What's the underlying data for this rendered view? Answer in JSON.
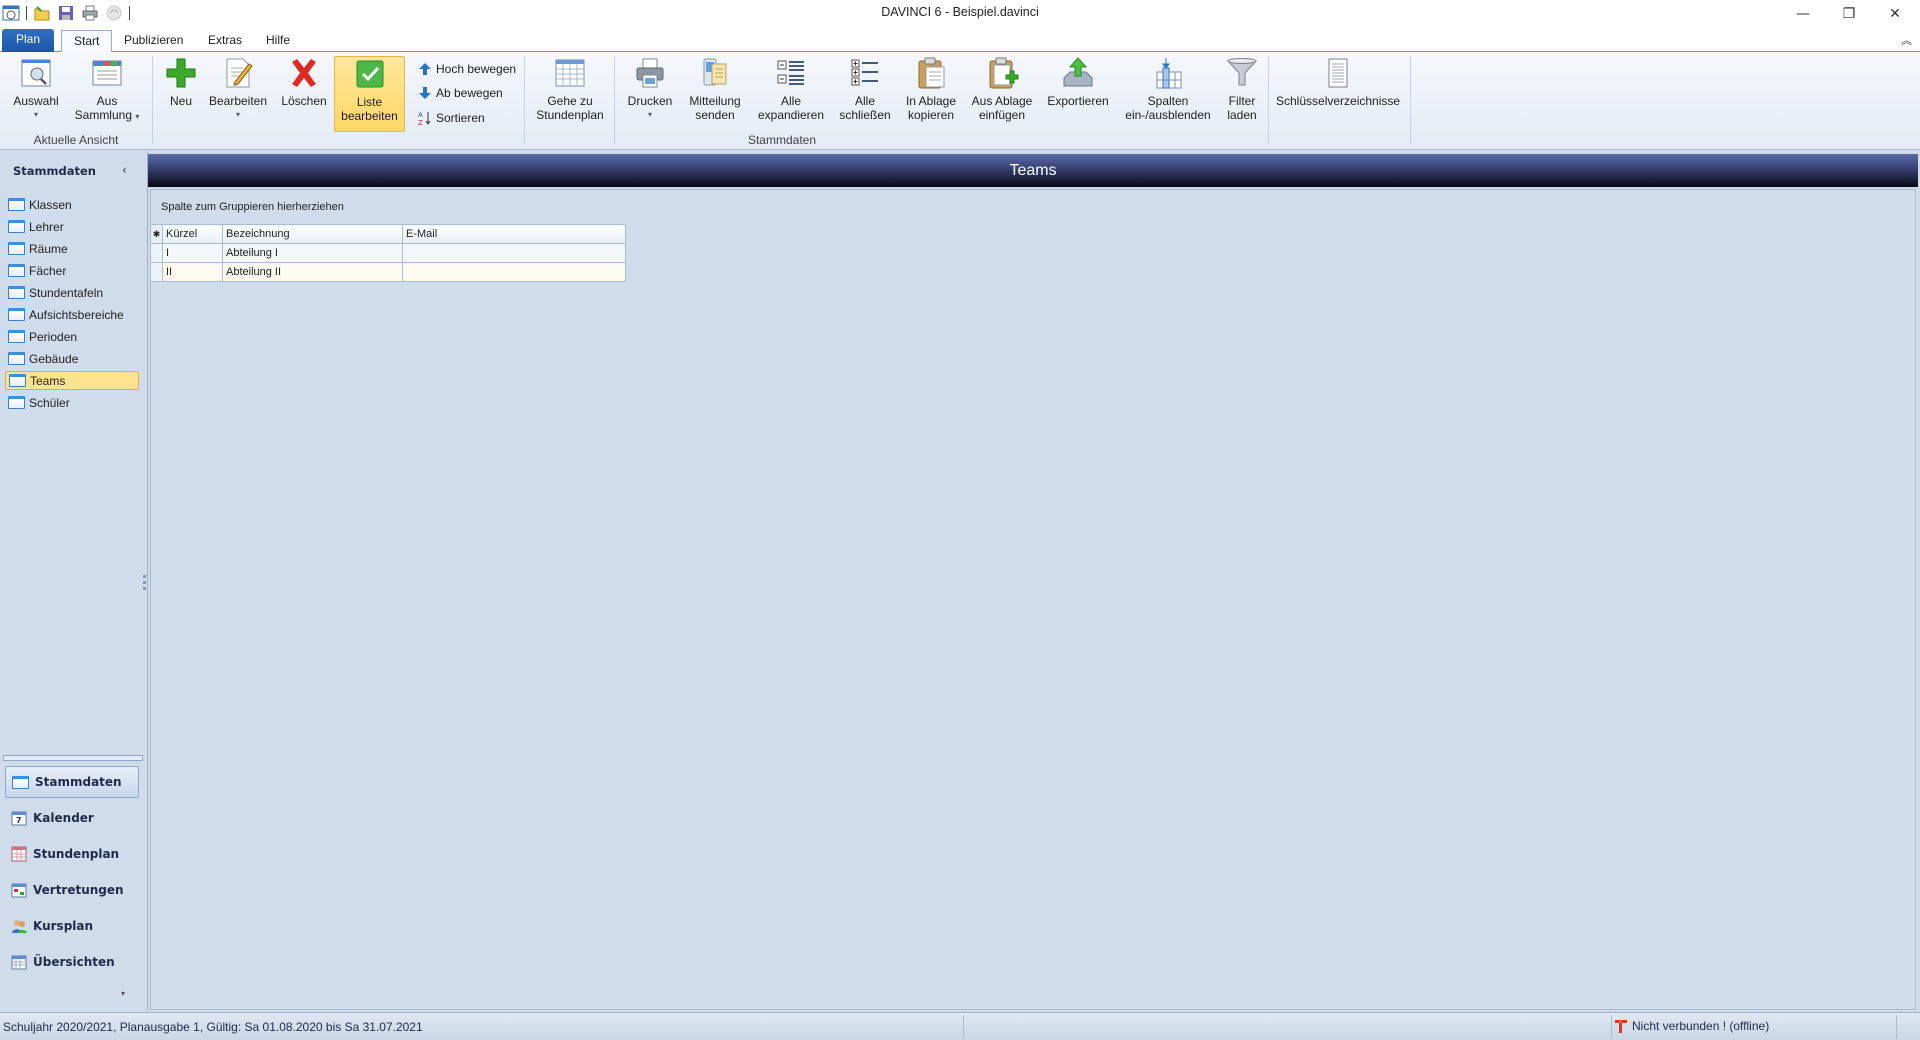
{
  "window": {
    "title": "DAVINCI 6 - Beispiel.davinci",
    "minimize_label": "—",
    "maximize_label": "❐",
    "close_label": "✕",
    "ribbon_collapse_label": "︽"
  },
  "quick_access": [
    "app-icon",
    "open-icon",
    "save-icon",
    "print-icon",
    "refresh-icon"
  ],
  "tabs": [
    {
      "label": "Plan",
      "active": false
    },
    {
      "label": "Start",
      "active": true
    },
    {
      "label": "Publizieren",
      "active": false
    },
    {
      "label": "Extras",
      "active": false
    },
    {
      "label": "Hilfe",
      "active": false
    }
  ],
  "ribbon": {
    "groups": {
      "aktuelle_ansicht": "Aktuelle Ansicht",
      "stammdaten": "Stammdaten"
    },
    "buttons": {
      "auswahl": "Auswahl",
      "aus_sammlung_1": "Aus",
      "aus_sammlung_2": "Sammlung",
      "neu": "Neu",
      "bearbeiten": "Bearbeiten",
      "loeschen": "Löschen",
      "liste_1": "Liste",
      "liste_2": "bearbeiten",
      "hoch": "Hoch bewegen",
      "ab": "Ab bewegen",
      "sortieren": "Sortieren",
      "gehe_1": "Gehe zu",
      "gehe_2": "Stundenplan",
      "drucken": "Drucken",
      "mitteilung_1": "Mitteilung",
      "mitteilung_2": "senden",
      "expand_1": "Alle",
      "expand_2": "expandieren",
      "collapse_1": "Alle",
      "collapse_2": "schließen",
      "copy_1": "In Ablage",
      "copy_2": "kopieren",
      "paste_1": "Aus Ablage",
      "paste_2": "einfügen",
      "export": "Exportieren",
      "spalten_1": "Spalten",
      "spalten_2": "ein-/ausblenden",
      "filter_1": "Filter",
      "filter_2": "laden",
      "schluessel": "Schlüsselverzeichnisse"
    }
  },
  "nav": {
    "header": "Stammdaten",
    "collapse_label": "‹",
    "items": [
      {
        "label": "Klassen",
        "selected": false
      },
      {
        "label": "Lehrer",
        "selected": false
      },
      {
        "label": "Räume",
        "selected": false
      },
      {
        "label": "Fächer",
        "selected": false
      },
      {
        "label": "Stundentafeln",
        "selected": false
      },
      {
        "label": "Aufsichtsbereiche",
        "selected": false
      },
      {
        "label": "Perioden",
        "selected": false
      },
      {
        "label": "Gebäude",
        "selected": false
      },
      {
        "label": "Teams",
        "selected": true
      },
      {
        "label": "Schüler",
        "selected": false
      }
    ],
    "bottom_items": [
      {
        "label": "Stammdaten",
        "icon": "folder-icon",
        "selected": true
      },
      {
        "label": "Kalender",
        "icon": "calendar-icon",
        "selected": false
      },
      {
        "label": "Stundenplan",
        "icon": "timetable-icon",
        "selected": false
      },
      {
        "label": "Vertretungen",
        "icon": "substitution-icon",
        "selected": false
      },
      {
        "label": "Kursplan",
        "icon": "people-icon",
        "selected": false
      },
      {
        "label": "Übersichten",
        "icon": "overview-icon",
        "selected": false
      }
    ],
    "more_label": "▾"
  },
  "main": {
    "title": "Teams",
    "group_hint": "Spalte zum Gruppieren hierherziehen",
    "grid": {
      "new_row_marker": "✱",
      "columns": [
        "Kürzel",
        "Bezeichnung",
        "E-Mail"
      ],
      "rows": [
        {
          "kuerzel": "I",
          "bezeichnung": "Abteilung I",
          "email": ""
        },
        {
          "kuerzel": "II",
          "bezeichnung": "Abteilung II",
          "email": ""
        }
      ]
    }
  },
  "status": {
    "left": "Schuljahr 2020/2021, Planausgabe 1, Gültig: Sa 01.08.2020 bis Sa 31.07.2021",
    "connection": "Nicht verbunden ! (offline)",
    "connection_color": "#d83a1e"
  }
}
